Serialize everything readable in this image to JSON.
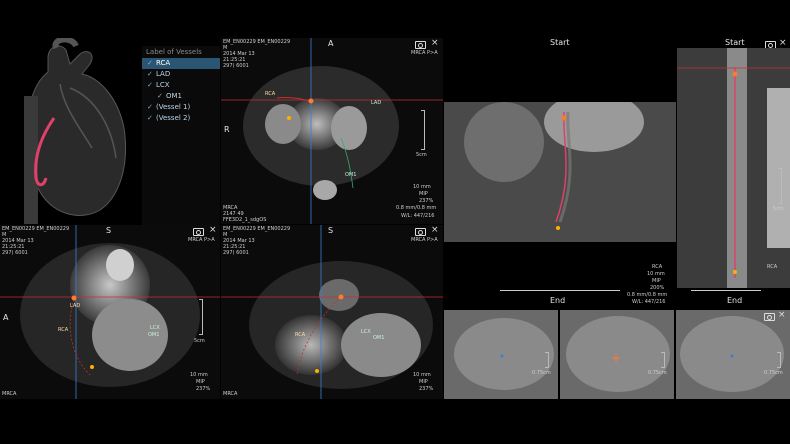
{
  "vessel_list": {
    "title": "Label of Vessels",
    "items": [
      {
        "label": "RCA",
        "selected": true,
        "indent": false
      },
      {
        "label": "LAD",
        "selected": false,
        "indent": false
      },
      {
        "label": "LCX",
        "selected": false,
        "indent": false
      },
      {
        "label": "OM1",
        "selected": false,
        "indent": true
      },
      {
        "label": "(Vessel 1)",
        "selected": false,
        "indent": false
      },
      {
        "label": "(Vessel 2)",
        "selected": false,
        "indent": false
      }
    ]
  },
  "axial_view": {
    "patient_line1": "EM_EN00229 EM_EN00229",
    "patient_line2": "M",
    "date": "2014 Mar 13",
    "time": "21:25:21",
    "series": "297) 6001",
    "orient_top": "A",
    "orient_left": "R",
    "mode": "MRCA P>A",
    "thickness": "10 mm",
    "render": "MIP",
    "zoom": "237%",
    "spacing": "0.8 mm/0.8 mm",
    "wl": "W/L: 447/216",
    "bottom_label": "MRCA",
    "bottom_line2": "2147 49",
    "bottom_line3": "FFE3D2_1_sdgOS",
    "scale_label": "5cm",
    "labels": {
      "rca": "RCA",
      "lad": "LAD",
      "om1": "OM1"
    }
  },
  "sagittal_view": {
    "patient_line1": "EM_EN00229 EM_EN00229",
    "patient_line2": "M",
    "date": "2014 Mar 13",
    "time": "21:25:21",
    "series": "297) 6001",
    "orient_top": "S",
    "orient_left": "A",
    "mode": "MRCA P>A",
    "thickness": "10 mm",
    "render": "MIP",
    "zoom": "237%",
    "bottom_label": "MRCA",
    "scale_label": "5cm",
    "labels": {
      "lad": "LAD",
      "lcx": "LCX",
      "om1": "OM1",
      "rca": "RCA"
    }
  },
  "coronal_view": {
    "patient_line1": "EM_EN00229 EM_EN00229",
    "patient_line2": "M",
    "date": "2014 Mar 13",
    "time": "21:25:21",
    "series": "297) 6001",
    "orient_top": "S",
    "mode": "MRCA P>A",
    "thickness": "10 mm",
    "render": "MIP",
    "zoom": "237%",
    "bottom_label": "MRCA",
    "labels": {
      "rca": "RCA",
      "lcx": "LCX",
      "om1": "OM1"
    }
  },
  "curved_view": {
    "start": "Start",
    "end": "End",
    "vessel": "RCA",
    "thickness": "10 mm",
    "render": "MIP",
    "zoom": "200%",
    "spacing": "0.8 mm/0.8 mm",
    "wl": "W/L: 447/216"
  },
  "straight_view": {
    "start": "Start",
    "end": "End",
    "vessel": "RCA",
    "scale_label": "5cm"
  },
  "cross_sections": [
    {
      "scale_label": "0.75cm"
    },
    {
      "scale_label": "0.75cm"
    },
    {
      "scale_label": "0.75cm"
    }
  ],
  "colors": {
    "selected_row": "#2a5674",
    "vessel_red": "#e0406a",
    "crosshair_red": "#c43030",
    "crosshair_blue": "#3a7fd0",
    "crosshair_green": "#2fae6a"
  }
}
